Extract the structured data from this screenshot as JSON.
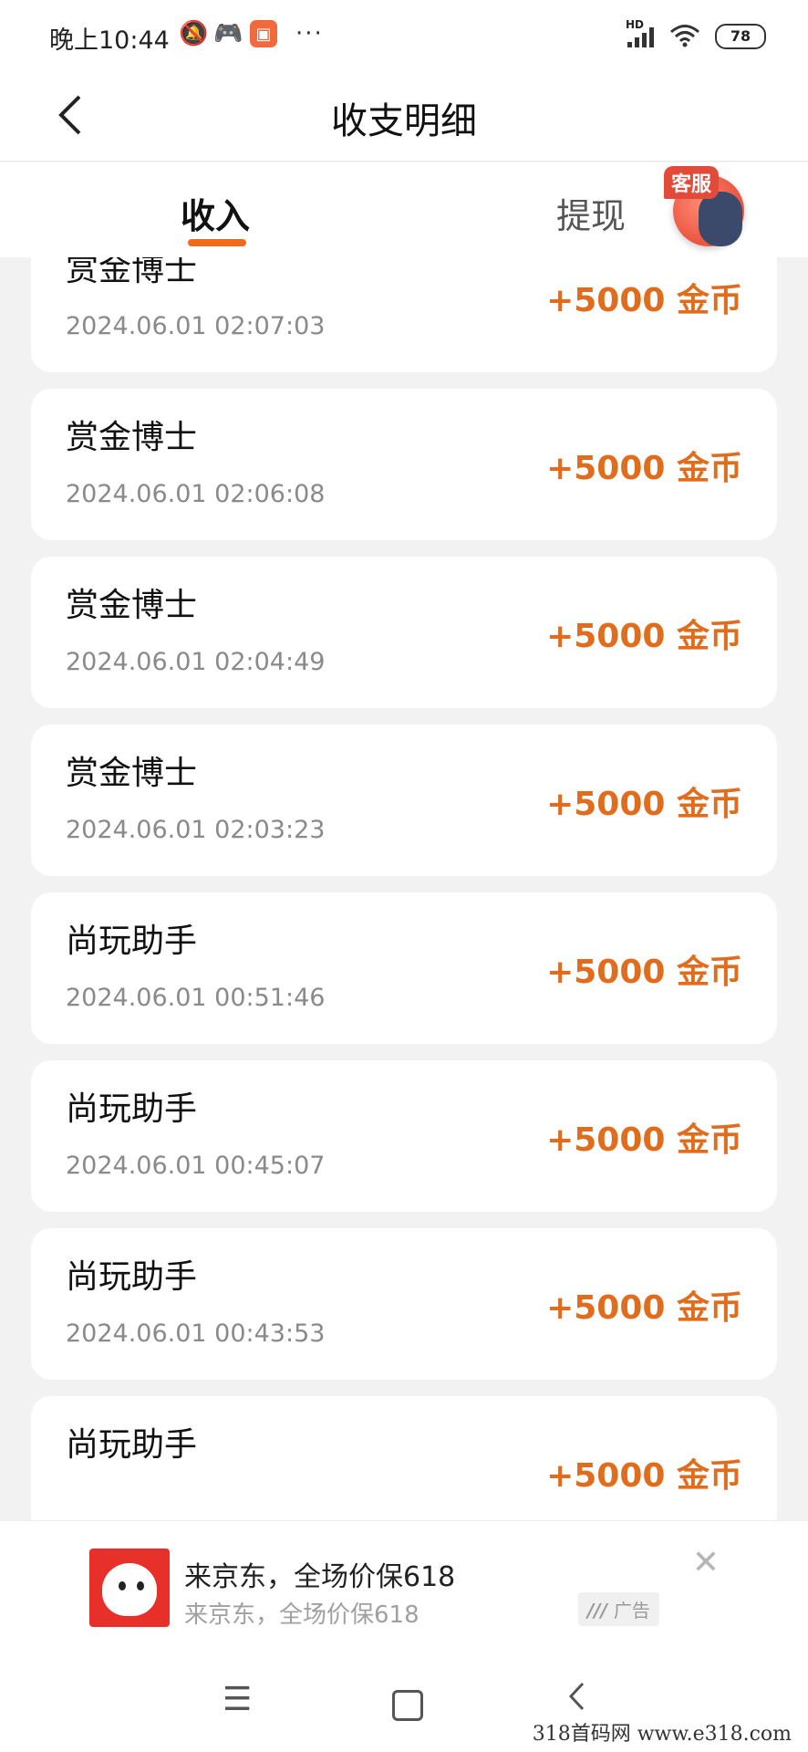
{
  "status_bar": {
    "time": "晚上10:44",
    "network_label": "HD",
    "battery": "78"
  },
  "header": {
    "title": "收支明细"
  },
  "tabs": [
    {
      "label": "收入",
      "active": true
    },
    {
      "label": "提现",
      "active": false
    }
  ],
  "customer_service": {
    "label": "客服"
  },
  "records": [
    {
      "name": "赏金博士",
      "time": "2024.06.01 02:07:03",
      "amount": "+5000 金币"
    },
    {
      "name": "赏金博士",
      "time": "2024.06.01 02:06:08",
      "amount": "+5000 金币"
    },
    {
      "name": "赏金博士",
      "time": "2024.06.01 02:04:49",
      "amount": "+5000 金币"
    },
    {
      "name": "赏金博士",
      "time": "2024.06.01 02:03:23",
      "amount": "+5000 金币"
    },
    {
      "name": "尚玩助手",
      "time": "2024.06.01 00:51:46",
      "amount": "+5000 金币"
    },
    {
      "name": "尚玩助手",
      "time": "2024.06.01 00:45:07",
      "amount": "+5000 金币"
    },
    {
      "name": "尚玩助手",
      "time": "2024.06.01 00:43:53",
      "amount": "+5000 金币"
    },
    {
      "name": "尚玩助手",
      "time": "",
      "amount": "+5000 金币"
    }
  ],
  "ad": {
    "title": "来京东，全场价保618",
    "subtitle": "来京东，全场价保618",
    "tag": "广告"
  },
  "watermark": "318首码网 www.e318.com",
  "colors": {
    "accent": "#f06a1c",
    "amount": "#e06d1e"
  }
}
